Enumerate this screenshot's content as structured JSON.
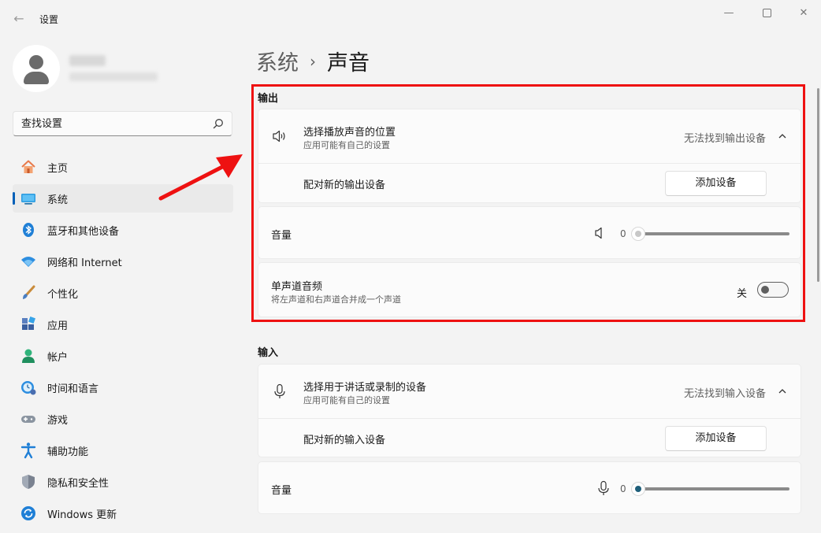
{
  "window": {
    "title": "设置",
    "back_icon": "back-arrow-icon",
    "controls": [
      "minimize-icon",
      "maximize-icon",
      "close-icon"
    ]
  },
  "search": {
    "placeholder": "查找设置"
  },
  "sidebar": {
    "items": [
      {
        "label": "主页",
        "icon": "home-icon",
        "active": false
      },
      {
        "label": "系统",
        "icon": "system-display-icon",
        "active": true
      },
      {
        "label": "蓝牙和其他设备",
        "icon": "bluetooth-icon",
        "active": false
      },
      {
        "label": "网络和 Internet",
        "icon": "wifi-icon",
        "active": false
      },
      {
        "label": "个性化",
        "icon": "brush-icon",
        "active": false
      },
      {
        "label": "应用",
        "icon": "apps-icon",
        "active": false
      },
      {
        "label": "帐户",
        "icon": "account-icon",
        "active": false
      },
      {
        "label": "时间和语言",
        "icon": "time-language-icon",
        "active": false
      },
      {
        "label": "游戏",
        "icon": "gamepad-icon",
        "active": false
      },
      {
        "label": "辅助功能",
        "icon": "accessibility-icon",
        "active": false
      },
      {
        "label": "隐私和安全性",
        "icon": "shield-icon",
        "active": false
      },
      {
        "label": "Windows 更新",
        "icon": "update-icon",
        "active": false
      }
    ]
  },
  "breadcrumb": {
    "parent": "系统",
    "separator": "›",
    "current": "声音"
  },
  "output": {
    "section_title": "输出",
    "device": {
      "title": "选择播放声音的位置",
      "subtitle": "应用可能有自己的设置",
      "status": "无法找到输出设备",
      "icon": "speaker-icon"
    },
    "pair": {
      "label": "配对新的输出设备",
      "button": "添加设备"
    },
    "volume": {
      "label": "音量",
      "value": "0",
      "icon": "speaker-muted-icon",
      "level": 0
    },
    "mono": {
      "title": "单声道音频",
      "subtitle": "将左声道和右声道合并成一个声道",
      "state": "关",
      "on": false
    }
  },
  "input": {
    "section_title": "输入",
    "device": {
      "title": "选择用于讲话或录制的设备",
      "subtitle": "应用可能有自己的设置",
      "status": "无法找到输入设备",
      "icon": "microphone-icon"
    },
    "pair": {
      "label": "配对新的输入设备",
      "button": "添加设备"
    },
    "volume": {
      "label": "音量",
      "value": "0",
      "icon": "microphone-icon",
      "level": 0
    }
  },
  "colors": {
    "accent": "#005fb8",
    "highlight": "#ee1111",
    "input_slider": "#1f5f7a"
  }
}
